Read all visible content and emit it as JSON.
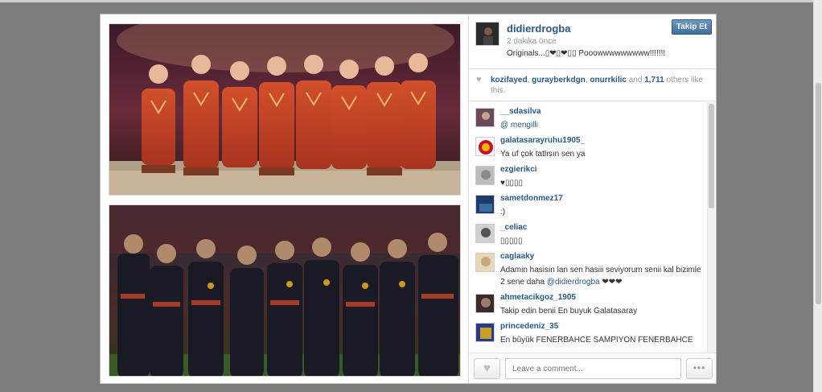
{
  "post": {
    "username": "didierdrogba",
    "timestamp": "2 dakika önce",
    "caption": "Originals...▯❤▯❤▯▯ Pooowwwwwwwww!!!!!!!",
    "follow_label": "Takip Et"
  },
  "likes": {
    "user1": "kozifayed",
    "user2": "gurayberkdgn",
    "user3": "onurrkilic",
    "and_text": " and ",
    "count": "1,711",
    "suffix": " others like this."
  },
  "comments": [
    {
      "user": "__sdasilva",
      "text": "@ mengilli",
      "avatar_color": "#6a4a5a"
    },
    {
      "user": "galatasarayruhu1905_",
      "text": "Ya uf çok tatlısın sen ya",
      "avatar_color": "#f2b400"
    },
    {
      "user": "ezgierikci",
      "text": "♥▯▯▯▯",
      "avatar_color": "#8a8a8a"
    },
    {
      "user": "sametdonmez17",
      "text": ":)",
      "avatar_color": "#1f3a6a"
    },
    {
      "user": "_celiac",
      "text": "▯▯▯▯▯",
      "avatar_color": "#555555"
    },
    {
      "user": "caglaaky",
      "text_before": "Adamin hasisin lan sen hasiii seviyorum senii kal bizimle 2 sene daha ",
      "mention": "@didierdrogba",
      "text_after": " ❤❤❤",
      "avatar_color": "#c9a77a"
    },
    {
      "user": "ahmetacikgoz_1905",
      "text": "Takip edin benii En buyuk Galatasaray",
      "avatar_color": "#3a2a2a"
    },
    {
      "user": "princedeniz_35",
      "text": "En büyük FENERBAHCE SAMPIYON FENERBAHCE",
      "avatar_color": "#c8a020"
    }
  ],
  "composer": {
    "placeholder": "Leave a comment...",
    "more_label": "•••"
  },
  "icons": {
    "like": "heart-icon",
    "more": "ellipsis-icon",
    "likes_indicator": "heart-small-icon"
  },
  "colors": {
    "link": "#2a5b84",
    "follow_button": "#4a7aa8",
    "backdrop": "#7d7d7d"
  }
}
